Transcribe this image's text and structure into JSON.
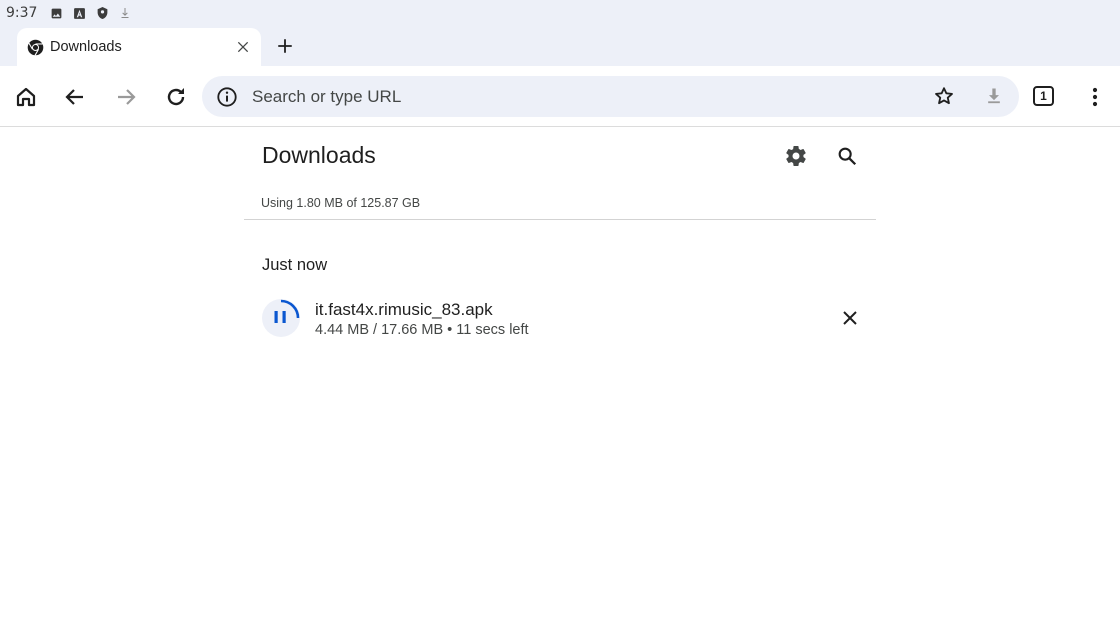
{
  "status_bar": {
    "time": "9:37",
    "icons": [
      "image-icon",
      "a-letter-icon",
      "shield-icon",
      "download-arrow-icon"
    ]
  },
  "tab": {
    "title": "Downloads",
    "favicon": "chrome-icon"
  },
  "toolbar": {
    "omnibox_placeholder": "Search or type URL",
    "tab_count": "1",
    "icons": [
      "home-icon",
      "back-icon",
      "forward-icon",
      "reload-icon",
      "info-icon",
      "star-icon",
      "download-icon",
      "tab-switcher-icon",
      "more-vert-icon"
    ]
  },
  "downloads": {
    "title": "Downloads",
    "storage_info": "Using 1.80 MB of 125.87 GB",
    "section_header": "Just now",
    "items": [
      {
        "filename": "it.fast4x.rimusic_83.apk",
        "status": "4.44 MB / 17.66 MB • 11 secs left",
        "progress": 0.25,
        "state": "paused"
      }
    ]
  },
  "colors": {
    "accent": "#0b57d0",
    "chrome_bg": "#edf0f8",
    "text_secondary": "#444746"
  }
}
